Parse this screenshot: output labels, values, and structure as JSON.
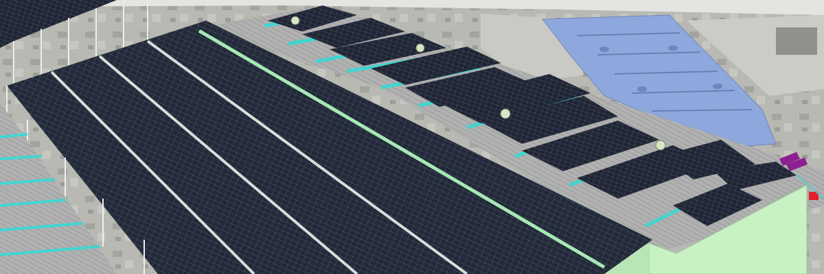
{
  "scene": {
    "kind": "3D model render of rooftop solar PV installation over satellite imagery",
    "colors": {
      "sky": "#e3e3df",
      "ground": "#b9bbb3",
      "blue_roof": "#8fa8dc",
      "metal_roof": "#a9a9a9",
      "panel": "#232a38",
      "panel_grid": "#5b6476",
      "teal_strip": "#3fd3cf",
      "mint_strip": "#a9e8b8",
      "wall_green": "#c8f0c4",
      "frame": "#f2f2f2",
      "magenta_marker": "#8a1e8f",
      "red_marker": "#e0202a"
    },
    "icons": [
      "roof-turbine-vent-icon",
      "section-marker-icon"
    ]
  }
}
